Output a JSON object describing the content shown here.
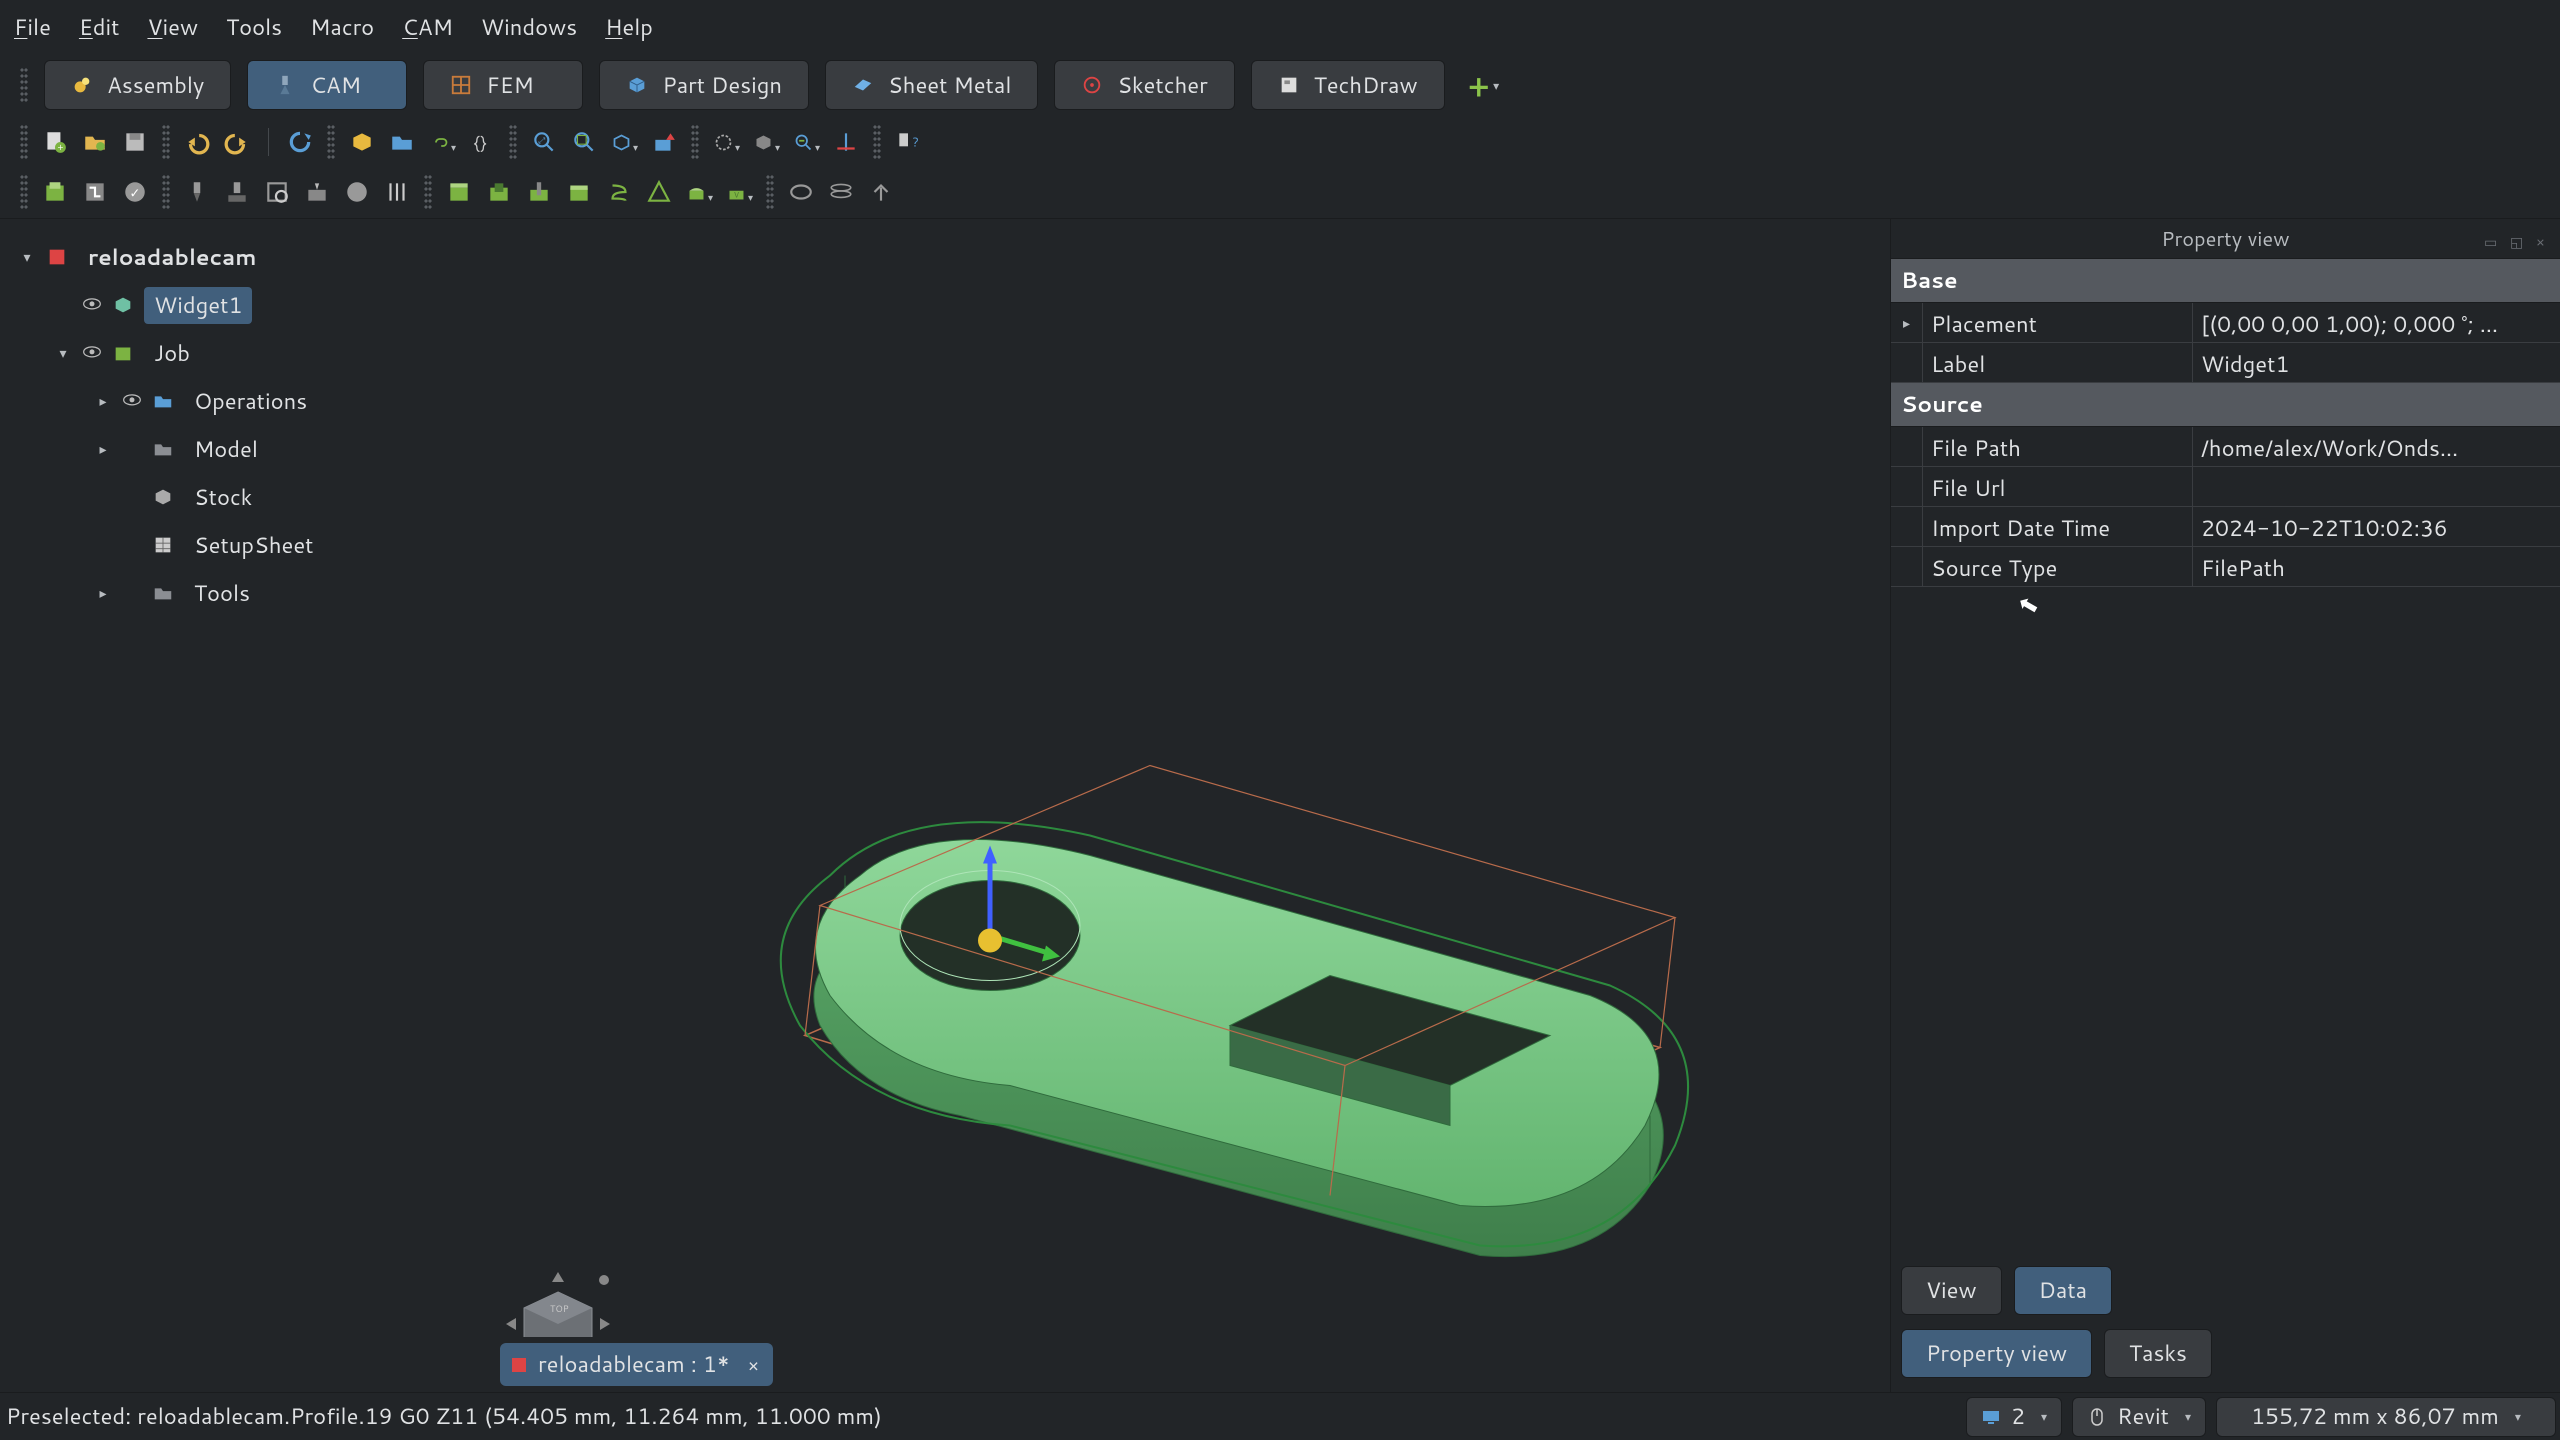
{
  "menu": {
    "file": "File",
    "edit": "Edit",
    "view": "View",
    "tools": "Tools",
    "macro": "Macro",
    "cam": "CAM",
    "windows": "Windows",
    "help": "Help"
  },
  "workbench": {
    "tabs": [
      {
        "label": "Assembly"
      },
      {
        "label": "CAM"
      },
      {
        "label": "FEM"
      },
      {
        "label": "Part Design"
      },
      {
        "label": "Sheet Metal"
      },
      {
        "label": "Sketcher"
      },
      {
        "label": "TechDraw"
      }
    ],
    "active_index": 1
  },
  "tree": {
    "root": "reloadablecam",
    "items": [
      {
        "label": "Widget1",
        "selected": true
      },
      {
        "label": "Job"
      },
      {
        "label": "Operations"
      },
      {
        "label": "Model"
      },
      {
        "label": "Stock"
      },
      {
        "label": "SetupSheet"
      },
      {
        "label": "Tools"
      }
    ]
  },
  "property_view": {
    "title": "Property view",
    "categories": {
      "Base": [
        {
          "key": "Placement",
          "value": "[(0,00 0,00 1,00); 0,000 °; …",
          "expand": true
        },
        {
          "key": "Label",
          "value": "Widget1"
        }
      ],
      "Source": [
        {
          "key": "File Path",
          "value": "/home/alex/Work/Onds…"
        },
        {
          "key": "File Url",
          "value": ""
        },
        {
          "key": "Import Date Time",
          "value": "2024-10-22T10:02:36"
        },
        {
          "key": "Source Type",
          "value": "FilePath"
        }
      ]
    },
    "tabs": {
      "view": "View",
      "data": "Data"
    },
    "bottom_tabs": {
      "prop": "Property view",
      "tasks": "Tasks"
    }
  },
  "doc_tab": {
    "label": "reloadablecam : 1*"
  },
  "status": {
    "msg": "Preselected: reloadablecam.Profile.19 G0 Z11 (54.405 mm, 11.264 mm, 11.000 mm)",
    "screens": "2",
    "nav_style": "Revit",
    "dims": "155,72 mm x 86,07 mm"
  },
  "icons": {
    "assembly": "⚙",
    "cam": "⛏",
    "fem": "▦",
    "partdesign": "◧",
    "sheetmetal": "▭",
    "sketcher": "✎",
    "techdraw": "▤"
  }
}
